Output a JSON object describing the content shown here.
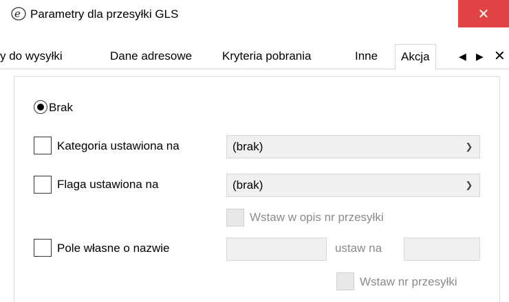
{
  "window": {
    "title": "Parametry dla przesyłki GLS",
    "close_label": "✕",
    "app_icon": "program-e-icon"
  },
  "tabs": {
    "items": [
      {
        "label": "y do wysyłki"
      },
      {
        "label": "Dane adresowe"
      },
      {
        "label": "Kryteria pobrania"
      },
      {
        "label": "Inne"
      },
      {
        "label": "Akcja"
      }
    ],
    "active": "Akcja",
    "prev_label": "◀",
    "next_label": "▶",
    "close_label": "✕"
  },
  "form": {
    "brak_label": "Brak",
    "brak_selected": true,
    "kategoria": {
      "label": "Kategoria ustawiona na",
      "checked": false,
      "value": "(brak)"
    },
    "flaga": {
      "label": "Flaga ustawiona na",
      "checked": false,
      "value": "(brak)"
    },
    "wstaw_opis": {
      "label": "Wstaw w opis nr przesyłki",
      "checked": false,
      "disabled": true
    },
    "pole": {
      "label": "Pole własne o nazwie",
      "checked": false,
      "name_value": "",
      "set_label": "ustaw na",
      "set_value": ""
    },
    "wstaw_nr": {
      "label": "Wstaw nr przesyłki",
      "checked": false,
      "disabled": true
    }
  }
}
